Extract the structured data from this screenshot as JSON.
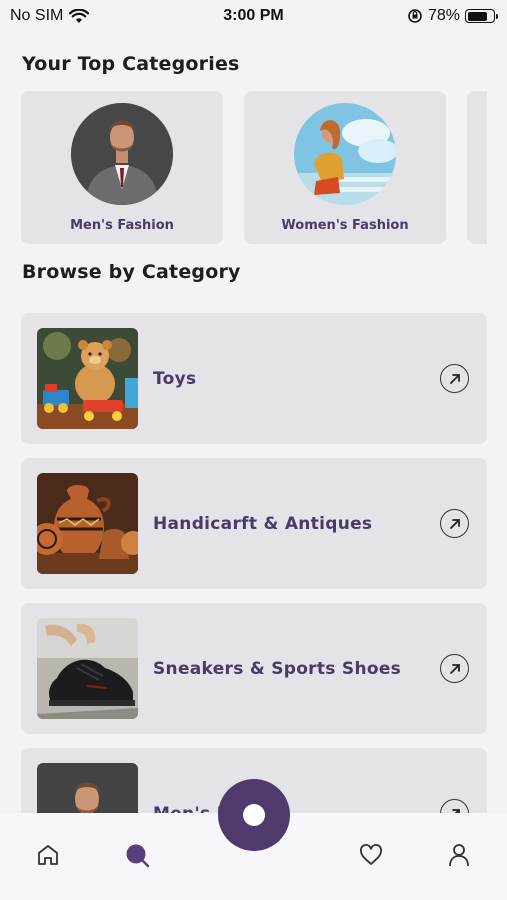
{
  "status_bar": {
    "carrier": "No SIM",
    "time": "3:00 PM",
    "battery": "78%",
    "battery_level": 0.78
  },
  "top_categories": {
    "title": "Your Top Categories",
    "items": [
      {
        "label": "Men's Fashion",
        "icon": "men-fashion-photo"
      },
      {
        "label": "Women's Fashion",
        "icon": "women-fashion-photo"
      }
    ]
  },
  "browse": {
    "title": "Browse by Category",
    "items": [
      {
        "label": "Toys",
        "icon": "teddy-bear-photo"
      },
      {
        "label": "Handicarft & Antiques",
        "icon": "pottery-photo"
      },
      {
        "label": "Sneakers & Sports Shoes",
        "icon": "sneaker-photo"
      },
      {
        "label": "Men's F",
        "icon": "men-fashion-photo"
      }
    ]
  },
  "nav": {
    "items": [
      "home-icon",
      "search-icon",
      "center-action",
      "heart-icon",
      "profile-icon"
    ],
    "active": "search-icon",
    "accent": "#4f3a6d"
  },
  "colors": {
    "background": "#f3f2f7",
    "card": "#e4e3e8",
    "label": "#4a3a68"
  }
}
